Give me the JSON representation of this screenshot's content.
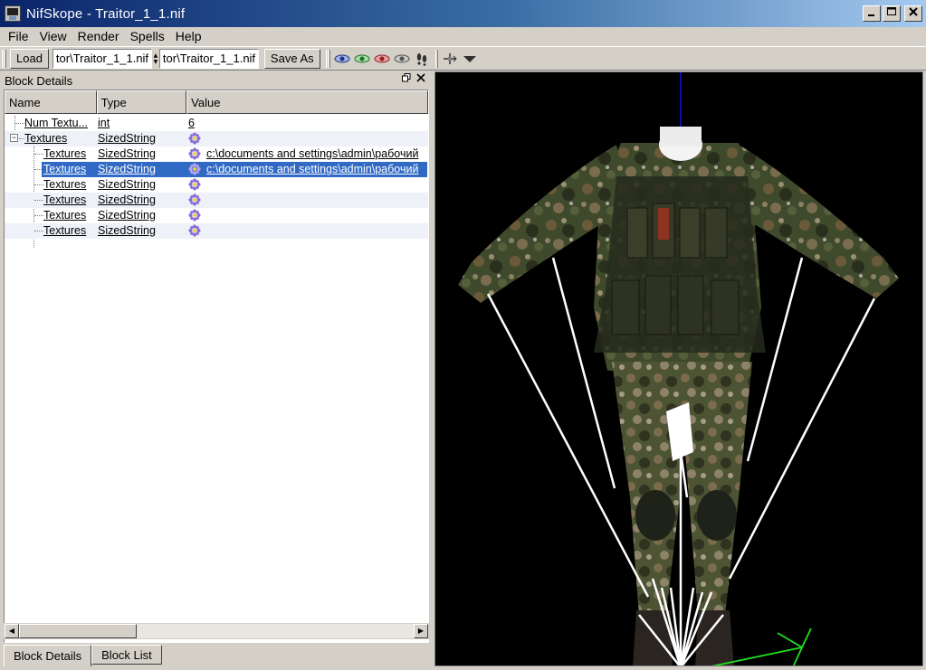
{
  "window": {
    "title": "NifSkope - Traitor_1_1.nif"
  },
  "menu": [
    "File",
    "View",
    "Render",
    "Spells",
    "Help"
  ],
  "toolbar": {
    "load_label": "Load",
    "load_path": "tor\\Traitor_1_1.nif",
    "save_path": "tor\\Traitor_1_1.nif",
    "save_as_label": "Save As"
  },
  "dock": {
    "title": "Block Details",
    "columns": [
      "Name",
      "Type",
      "Value"
    ],
    "rows": [
      {
        "name": "Num Textu...",
        "type": "int",
        "value": "6"
      },
      {
        "name": "Textures",
        "type": "SizedString",
        "value": ""
      },
      {
        "name": "Textures",
        "type": "SizedString",
        "value": "c:\\documents and settings\\admin\\рабочий"
      },
      {
        "name": "Textures",
        "type": "SizedString",
        "value": "c:\\documents and settings\\admin\\рабочий"
      },
      {
        "name": "Textures",
        "type": "SizedString",
        "value": ""
      },
      {
        "name": "Textures",
        "type": "SizedString",
        "value": ""
      },
      {
        "name": "Textures",
        "type": "SizedString",
        "value": ""
      },
      {
        "name": "Textures",
        "type": "SizedString",
        "value": ""
      }
    ],
    "tabs": [
      "Block Details",
      "Block List"
    ]
  },
  "colors": {
    "selection": "#316ac5",
    "titlebar_start": "#0a246a",
    "titlebar_end": "#a6caf0",
    "viewport_bg": "#000000"
  },
  "icons": [
    "nifskope-app-icon",
    "eye-blue-icon",
    "eye-green-icon",
    "eye-red-icon",
    "eye-gray-icon",
    "footprints-icon",
    "axes-icon",
    "dropdown-icon",
    "flower-icon"
  ]
}
